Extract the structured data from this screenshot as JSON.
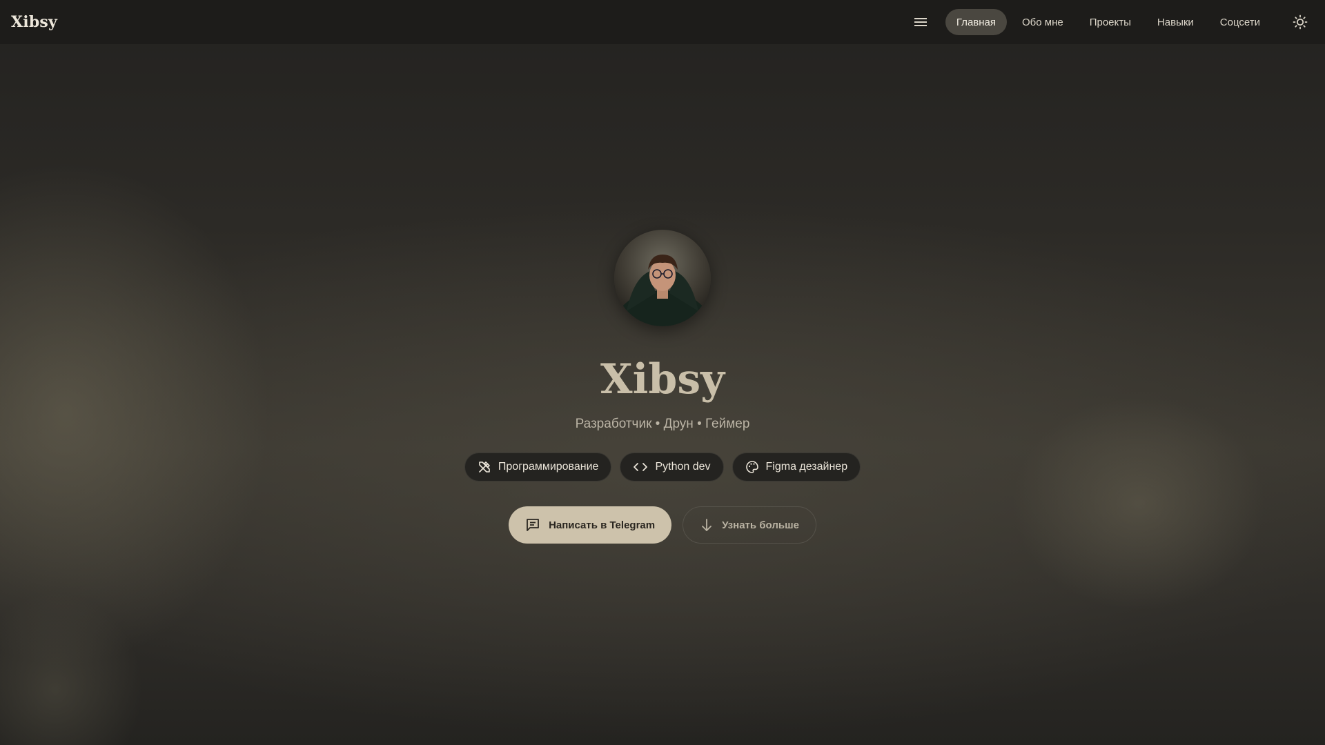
{
  "header": {
    "brand": "Xibsy",
    "menu_icon": "menu-icon",
    "nav": [
      {
        "label": "Главная",
        "active": true
      },
      {
        "label": "Обо мне",
        "active": false
      },
      {
        "label": "Проекты",
        "active": false
      },
      {
        "label": "Навыки",
        "active": false
      },
      {
        "label": "Соцсети",
        "active": false
      }
    ],
    "theme_icon": "sun-icon"
  },
  "hero": {
    "avatar_alt": "avatar photo",
    "title": "Xibsy",
    "subtitle": "Разработчик • Друн • Геймер",
    "chips": [
      {
        "icon": "tools-icon",
        "label": "Программирование"
      },
      {
        "icon": "code-icon",
        "label": "Python dev"
      },
      {
        "icon": "palette-icon",
        "label": "Figma дезайнер"
      }
    ],
    "primary_button": {
      "icon": "message-icon",
      "label": "Написать в Telegram"
    },
    "secondary_button": {
      "icon": "arrow-down-icon",
      "label": "Узнать больше"
    }
  },
  "colors": {
    "accent": "#cdc2ab",
    "title": "#c9bfa9",
    "topbar": "#1d1c1a",
    "active_nav": "#4a4740"
  }
}
